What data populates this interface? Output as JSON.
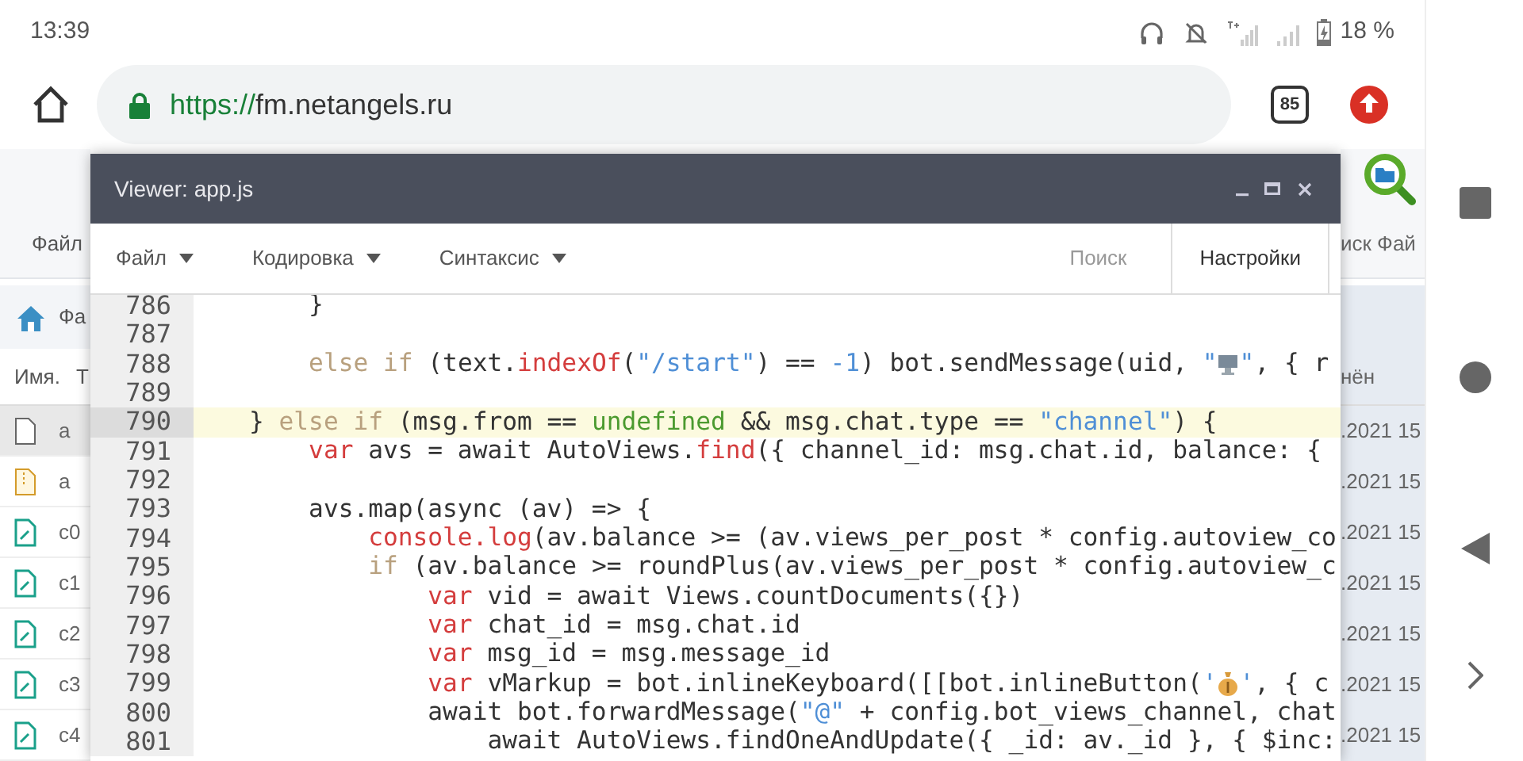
{
  "status_bar": {
    "time": "13:39",
    "battery": "18 %"
  },
  "browser": {
    "url_scheme": "https://",
    "url_host": "fm.netangels.ru",
    "tab_count": "85"
  },
  "background": {
    "menu_label": "Файл",
    "breadcrumb": "Фа",
    "name_column": "Имя.",
    "type_column": "Т",
    "search_label": "иск Фай",
    "modified_column": "нён",
    "files": [
      {
        "kind": "file",
        "name": "a",
        "date": ".2021 15",
        "selected": true
      },
      {
        "kind": "archive",
        "name": "a",
        "date": ".2021 15",
        "selected": false
      },
      {
        "kind": "script",
        "name": "c0",
        "date": ".2021 15",
        "selected": false
      },
      {
        "kind": "script",
        "name": "c1",
        "date": ".2021 15",
        "selected": false
      },
      {
        "kind": "script",
        "name": "c2",
        "date": ".2021 15",
        "selected": false
      },
      {
        "kind": "script",
        "name": "c3",
        "date": ".2021 15",
        "selected": false
      },
      {
        "kind": "script",
        "name": "c4",
        "date": ".2021 15",
        "selected": false
      }
    ]
  },
  "viewer": {
    "title": "Viewer: app.js",
    "menus": [
      {
        "label": "Файл"
      },
      {
        "label": "Кодировка"
      },
      {
        "label": "Синтаксис"
      }
    ],
    "search": "Поиск",
    "settings": "Настройки",
    "lines": [
      {
        "number": "786",
        "highlighted": false,
        "tokens": [
          {
            "kind": "plain",
            "text": "    }"
          }
        ]
      },
      {
        "number": "787",
        "highlighted": false
      },
      {
        "number": "788",
        "highlighted": false,
        "tokens": [
          {
            "kind": "ctrl",
            "text": "    else if "
          },
          {
            "kind": "plain",
            "text": "(text."
          },
          {
            "kind": "decl",
            "text": "indexOf"
          },
          {
            "kind": "plain",
            "text": "("
          },
          {
            "kind": "str",
            "text": "\"/start\""
          },
          {
            "kind": "plain",
            "text": ") == "
          },
          {
            "kind": "str",
            "text": "-1"
          },
          {
            "kind": "plain",
            "text": ") bot.sendMessage(uid, "
          },
          {
            "kind": "str",
            "text": "\""
          },
          {
            "kind": "monitor"
          },
          {
            "kind": "str",
            "text": "\""
          },
          {
            "kind": "plain",
            "text": ", { r"
          }
        ]
      },
      {
        "number": "789",
        "highlighted": false
      },
      {
        "number": "790",
        "highlighted": true,
        "tokens": [
          {
            "kind": "plain",
            "text": "} "
          },
          {
            "kind": "ctrl",
            "text": "else if "
          },
          {
            "kind": "plain",
            "text": "(msg.from == "
          },
          {
            "kind": "lit",
            "text": "undefined"
          },
          {
            "kind": "plain",
            "text": " && msg.chat.type == "
          },
          {
            "kind": "str",
            "text": "\"channel\""
          },
          {
            "kind": "plain",
            "text": ") {"
          }
        ]
      },
      {
        "number": "791",
        "highlighted": false,
        "tokens": [
          {
            "kind": "decl",
            "text": "    var"
          },
          {
            "kind": "plain",
            "text": " avs = await AutoViews."
          },
          {
            "kind": "decl",
            "text": "find"
          },
          {
            "kind": "plain",
            "text": "({ channel_id: msg.chat.id, balance: {"
          }
        ]
      },
      {
        "number": "792",
        "highlighted": false
      },
      {
        "number": "793",
        "highlighted": false,
        "tokens": [
          {
            "kind": "plain",
            "text": "    avs.map(async (av) => {"
          }
        ]
      },
      {
        "number": "794",
        "highlighted": false,
        "tokens": [
          {
            "kind": "decl",
            "text": "        console.log"
          },
          {
            "kind": "plain",
            "text": "(av.balance >= (av.views_per_post * config.autoview_co"
          }
        ]
      },
      {
        "number": "795",
        "highlighted": false,
        "tokens": [
          {
            "kind": "ctrl",
            "text": "        if"
          },
          {
            "kind": "plain",
            "text": " (av.balance >= roundPlus(av.views_per_post * config.autoview_c"
          }
        ]
      },
      {
        "number": "796",
        "highlighted": false,
        "tokens": [
          {
            "kind": "decl",
            "text": "            var"
          },
          {
            "kind": "plain",
            "text": " vid = await Views.countDocuments({})"
          }
        ]
      },
      {
        "number": "797",
        "highlighted": false,
        "tokens": [
          {
            "kind": "decl",
            "text": "            var"
          },
          {
            "kind": "plain",
            "text": " chat_id = msg.chat.id"
          }
        ]
      },
      {
        "number": "798",
        "highlighted": false,
        "tokens": [
          {
            "kind": "decl",
            "text": "            var"
          },
          {
            "kind": "plain",
            "text": " msg_id = msg.message_id"
          }
        ]
      },
      {
        "number": "799",
        "highlighted": false,
        "tokens": [
          {
            "kind": "decl",
            "text": "            var"
          },
          {
            "kind": "plain",
            "text": " vMarkup = bot.inlineKeyboard([[bot.inlineButton("
          },
          {
            "kind": "str",
            "text": "'"
          },
          {
            "kind": "moneybag"
          },
          {
            "kind": "str",
            "text": "'"
          },
          {
            "kind": "plain",
            "text": ", { c"
          }
        ]
      },
      {
        "number": "800",
        "highlighted": false,
        "tokens": [
          {
            "kind": "plain",
            "text": "            await bot.forwardMessage("
          },
          {
            "kind": "str",
            "text": "\"@\""
          },
          {
            "kind": "plain",
            "text": " + config.bot_views_channel, chat"
          }
        ]
      },
      {
        "number": "801",
        "highlighted": false,
        "tokens": [
          {
            "kind": "plain",
            "text": "                await AutoViews.findOneAndUpdate({ _id: av._id }, { $inc:"
          }
        ]
      }
    ]
  }
}
